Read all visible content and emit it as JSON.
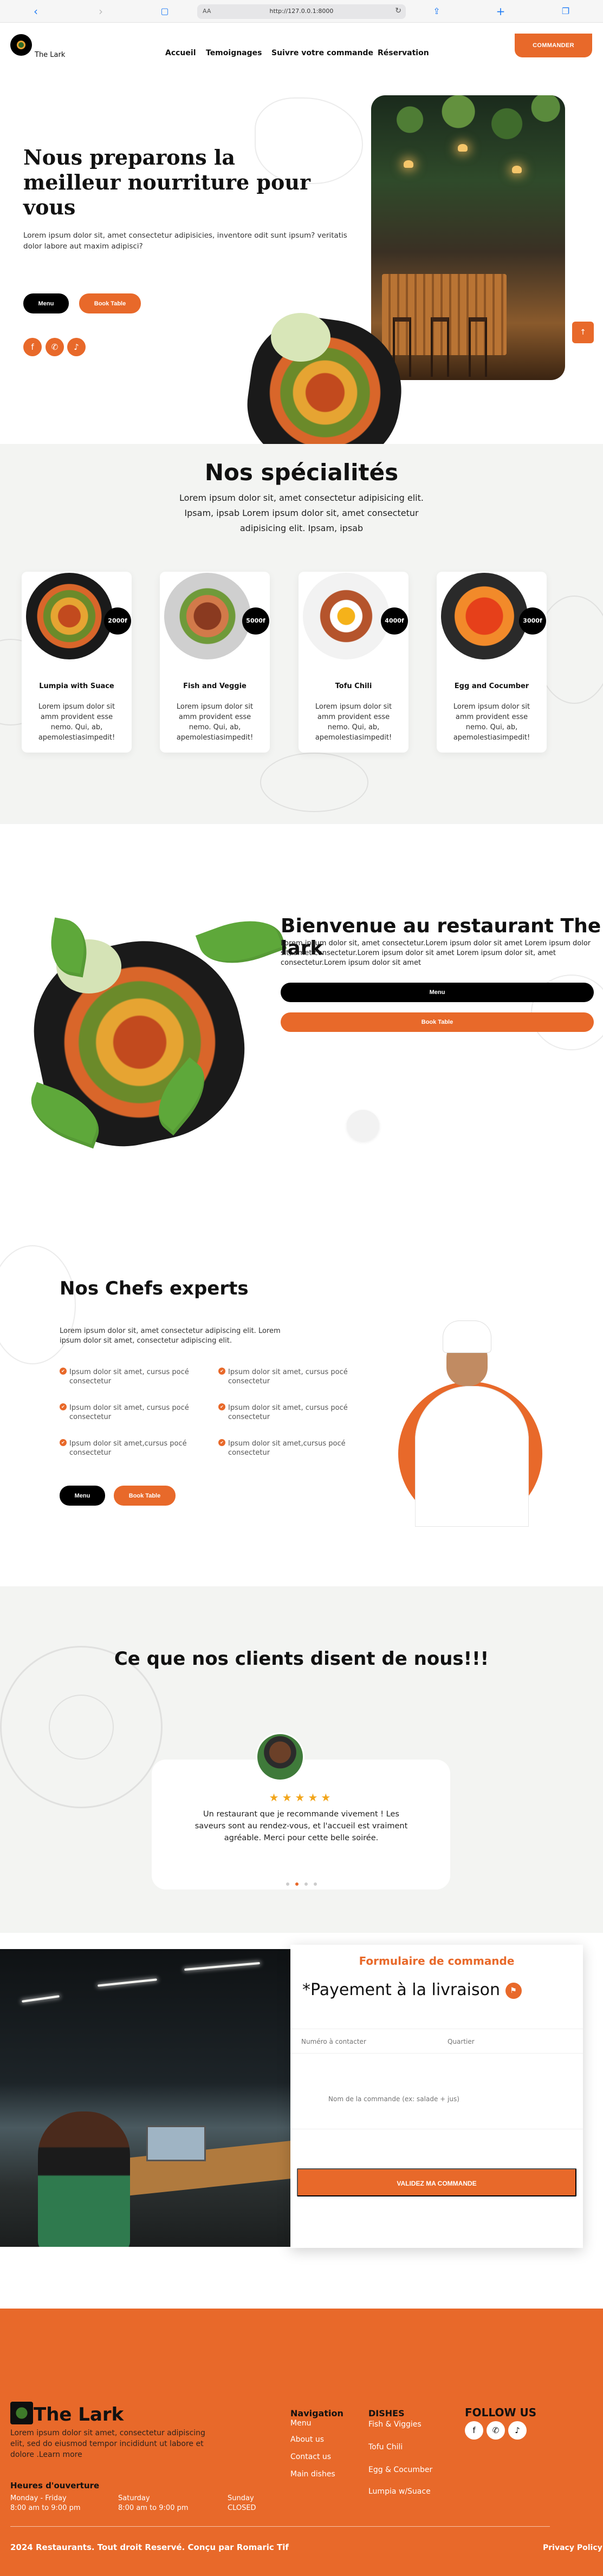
{
  "browser": {
    "url": "http://127.0.0.1:8000",
    "text_size_label": "AA"
  },
  "header": {
    "brand": "The Lark",
    "nav": [
      "Accueil",
      "Temoignages",
      "Suivre votre commande",
      "Réservation"
    ],
    "order_button": "COMMANDER"
  },
  "hero": {
    "title": "Nous preparons la meilleur nourriture pour vous",
    "description": "Lorem ipsum dolor sit, amet consectetur adipisicies, inventore odit sunt ipsum? veritatis dolor labore aut maxim adipisci?",
    "menu_button": "Menu",
    "table_button": "Book Table",
    "side_tab": "↑"
  },
  "specialties": {
    "title": "Nos spécialités",
    "subtitle": "Lorem ipsum dolor sit, amet consectetur adipisicing elit. Ipsam, ipsab Lorem ipsum dolor sit, amet consectetur adipisicing elit. Ipsam, ipsab",
    "items": [
      {
        "name": "Lumpia with Suace",
        "price": "2000f",
        "description": "Lorem ipsum dolor sit amm provident esse nemo. Qui, ab, apemolestiasimpedit!"
      },
      {
        "name": "Fish and Veggie",
        "price": "5000f",
        "description": "Lorem ipsum dolor sit amm provident esse nemo. Qui, ab, apemolestiasimpedit!"
      },
      {
        "name": "Tofu Chili",
        "price": "4000f",
        "description": "Lorem ipsum dolor sit amm provident esse nemo. Qui, ab, apemolestiasimpedit!"
      },
      {
        "name": "Egg and Cocumber",
        "price": "3000f",
        "description": "Lorem ipsum dolor sit amm provident esse nemo. Qui, ab, apemolestiasimpedit!"
      }
    ]
  },
  "welcome": {
    "title": "Bienvenue au restaurant The lark",
    "text": "Lorem ipsum dolor sit, amet consectetur.Lorem ipsum dolor sit amet Lorem ipsum dolor sit, amet consectetur.Lorem ipsum dolor sit amet Lorem ipsum dolor sit, amet consectetur.Lorem ipsum dolor sit amet",
    "menu_button": "Menu",
    "table_button": "Book Table"
  },
  "chefs": {
    "title": "Nos Chefs experts",
    "description": "Lorem ipsum dolor sit, amet consectetur adipiscing elit. Lorem ipsum dolor sit amet, consectetur adipiscing elit.",
    "points": [
      "Ipsum dolor sit amet, cursus pocé consectetur",
      "Ipsum dolor sit amet, cursus pocé consectetur",
      "Ipsum dolor sit amet, cursus pocé consectetur",
      "Ipsum dolor sit amet, cursus pocé consectetur",
      "Ipsum dolor sit amet,cursus pocé consectetur",
      "Ipsum dolor sit amet,cursus pocé consectetur"
    ],
    "menu_button": "Menu",
    "table_button": "Book Table"
  },
  "testimonials": {
    "title": "Ce que nos clients disent de nous!!!",
    "stars": "★★★★★",
    "quote": "Un restaurant que je recommande vivement ! Les saveurs sont au rendez-vous, et l'accueil est vraiment agréable. Merci pour cette belle soirée."
  },
  "order": {
    "title": "Formulaire de commande",
    "payment": "*Payement à la livraison",
    "phone_placeholder": "Numéro à contacter",
    "district_placeholder": "Quartier",
    "dish_placeholder": "Nom de la commande (ex: salade + jus)",
    "submit": "VALIDEZ MA COMMANDE"
  },
  "footer": {
    "brand": "The Lark",
    "description": "Lorem ipsum dolor sit amet, consectetur adipiscing elit, sed do eiusmod tempor incididunt ut labore et dolore .Learn more",
    "hours_title": "Heures d'ouverture",
    "hours": [
      {
        "day": "Monday - Friday",
        "time": "8:00 am to 9:00 pm"
      },
      {
        "day": "Saturday",
        "time": "8:00 am to 9:00 pm"
      },
      {
        "day": "Sunday",
        "time": "CLOSED"
      }
    ],
    "navigation_title": "Navigation",
    "navigation": [
      "Menu",
      "About us",
      "Contact us",
      "Main dishes"
    ],
    "dishes_title": "DISHES",
    "dishes": [
      "Fish & Viggies",
      "Tofu Chili",
      "Egg & Cocumber",
      "Lumpia w/Suace"
    ],
    "follow_title": "FOLLOW US",
    "copyright": "2024 Restaurants. Tout droit Reservé. Conçu par Romaric Tif",
    "privacy": "Privacy Policy"
  },
  "colors": {
    "accent": "#e8692a",
    "dark": "#000000",
    "section_bg": "#f3f4f2"
  }
}
